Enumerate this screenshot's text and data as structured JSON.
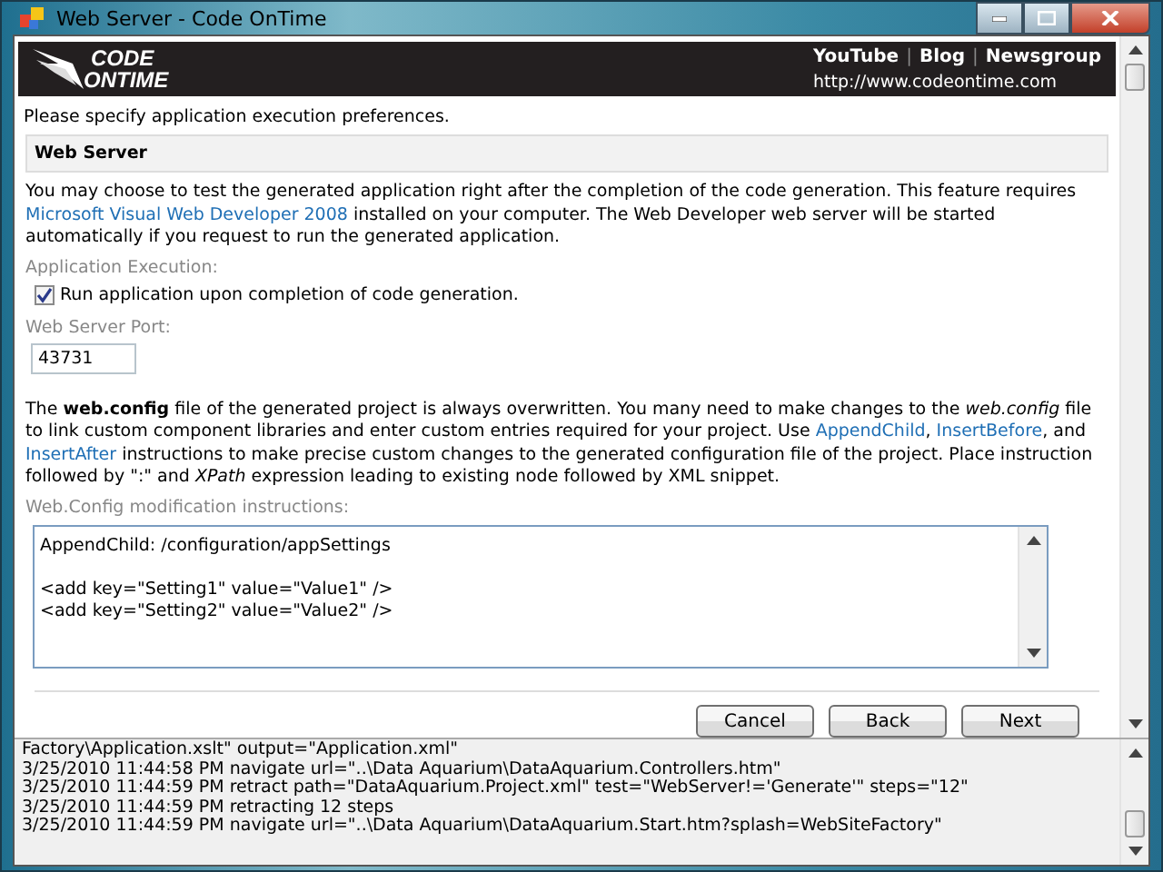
{
  "window": {
    "title": "Web Server - Code OnTime"
  },
  "header": {
    "logo": [
      "CODE",
      "ONTIME"
    ],
    "links": [
      "YouTube",
      "Blog",
      "Newsgroup"
    ],
    "separator": "|",
    "url": "http://www.codeontime.com"
  },
  "intro": "Please specify application execution preferences.",
  "section_title": "Web Server",
  "description": [
    {
      "kind": "text",
      "text": "You may choose to test the generated application right after the completion of the code generation. This feature requires "
    },
    {
      "kind": "link",
      "text": "Microsoft Visual Web Developer 2008"
    },
    {
      "kind": "text",
      "text": " installed on your computer. The Web Developer web server will be started automatically if you request to run the generated application."
    }
  ],
  "execution": {
    "label": "Application Execution:",
    "checkbox": {
      "label": "Run application upon completion of code generation.",
      "checked": true
    }
  },
  "port": {
    "label": "Web Server Port:",
    "value": "43731"
  },
  "config_text": [
    {
      "kind": "text",
      "text": "The **web.config** file of the generated project is always overwritten. You many need to make changes to the *web.config* file to link custom component libraries and enter custom entries required for your project. Use "
    },
    {
      "kind": "link",
      "text": "AppendChild"
    },
    {
      "kind": "text",
      "text": ", "
    },
    {
      "kind": "link",
      "text": "InsertBefore"
    },
    {
      "kind": "text",
      "text": ", and "
    },
    {
      "kind": "link",
      "text": "InsertAfter"
    },
    {
      "kind": "text",
      "text": " instructions to make precise custom changes to the generated configuration file of the project. Place instruction followed by \":\" and *XPath* expression leading to existing node followed by XML snippet."
    }
  ],
  "instructions": {
    "label": "Web.Config modification instructions:",
    "value": "AppendChild: /configuration/appSettings\n\n<add key=\"Setting1\" value=\"Value1\" />\n<add key=\"Setting2\" value=\"Value2\" />"
  },
  "buttons": [
    "Cancel",
    "Back",
    "Next"
  ],
  "log": [
    "Factory\\Application.xslt\" output=\"Application.xml\"",
    "3/25/2010 11:44:58 PM navigate url=\"..\\Data Aquarium\\DataAquarium.Controllers.htm\"",
    "3/25/2010 11:44:59 PM retract path=\"DataAquarium.Project.xml\" test=\"WebServer!='Generate'\" steps=\"12\"",
    "3/25/2010 11:44:59 PM retracting 12 steps",
    "3/25/2010 11:44:59 PM navigate url=\"..\\Data Aquarium\\DataAquarium.Start.htm?splash=WebSiteFactory\""
  ]
}
